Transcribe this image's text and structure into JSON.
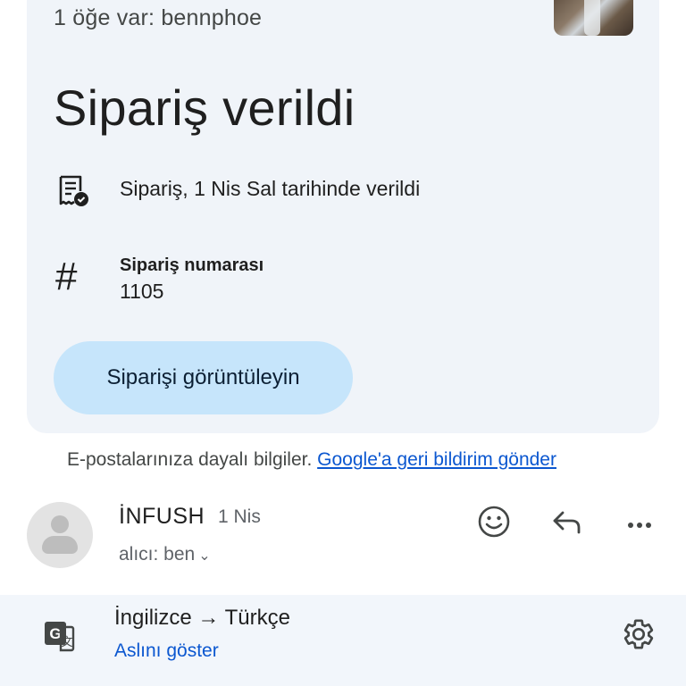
{
  "card": {
    "items_summary": "1 öğe var: bennphoe",
    "title": "Sipariş verildi",
    "placed_text": "Sipariş, 1 Nis Sal tarihinde verildi",
    "order_label": "Sipariş numarası",
    "order_number": "1105",
    "view_button": "Siparişi görüntüleyin",
    "hash_symbol": "#",
    "receipt_icon": "receipt-check-icon",
    "thumbnail_icon": "product-thumbnail"
  },
  "disclaimer": {
    "text": "E-postalarınıza dayalı bilgiler.",
    "link": "Google'a geri bildirim gönder"
  },
  "message": {
    "sender": "İNFUSH",
    "date": "1 Nis",
    "recipient": "alıcı: ben",
    "chevron": "⌄",
    "actions": [
      "emoji-icon",
      "reply-icon",
      "more-icon"
    ]
  },
  "translate": {
    "languages": "İngilizce → Türkçe",
    "show_original": "Aslını göster",
    "icons": [
      "translate-icon",
      "settings-gear-icon"
    ]
  },
  "colors": {
    "card_bg": "#f0f4f9",
    "button_bg": "#c6e5fb",
    "link": "#0b57d0",
    "translate_bar_bg": "#f2f6fb"
  }
}
